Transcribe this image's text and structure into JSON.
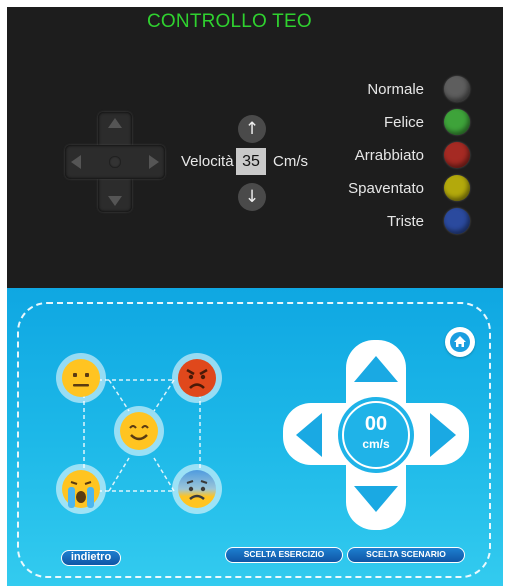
{
  "app": {
    "title": "CONTROLLO TEO"
  },
  "speed_panel": {
    "label": "Velocità",
    "value": "35",
    "unit": "Cm/s",
    "up_icon": "arrow-up-icon",
    "down_icon": "arrow-down-icon"
  },
  "emotions": [
    {
      "label": "Normale",
      "color": "#5e5e5e"
    },
    {
      "label": "Felice",
      "color": "#3ea33a"
    },
    {
      "label": "Arrabbiato",
      "color": "#a52a23"
    },
    {
      "label": "Spaventato",
      "color": "#b3a90c"
    },
    {
      "label": "Triste",
      "color": "#2b4a9e"
    }
  ],
  "controller": {
    "speed_value": "00",
    "speed_unit": "cm/s",
    "emoji_icons": [
      "neutral-face-icon",
      "angry-face-icon",
      "smiling-face-icon",
      "crying-face-icon",
      "anxious-face-icon"
    ]
  },
  "buttons": {
    "back": "indietro",
    "exercise": "SCELTA ESERCIZIO",
    "scenario": "SCELTA SCENARIO"
  },
  "colors": {
    "title_green": "#2fd12f",
    "top_bg": "#1d1d1d",
    "bottom_bg": "#1db8e8"
  }
}
